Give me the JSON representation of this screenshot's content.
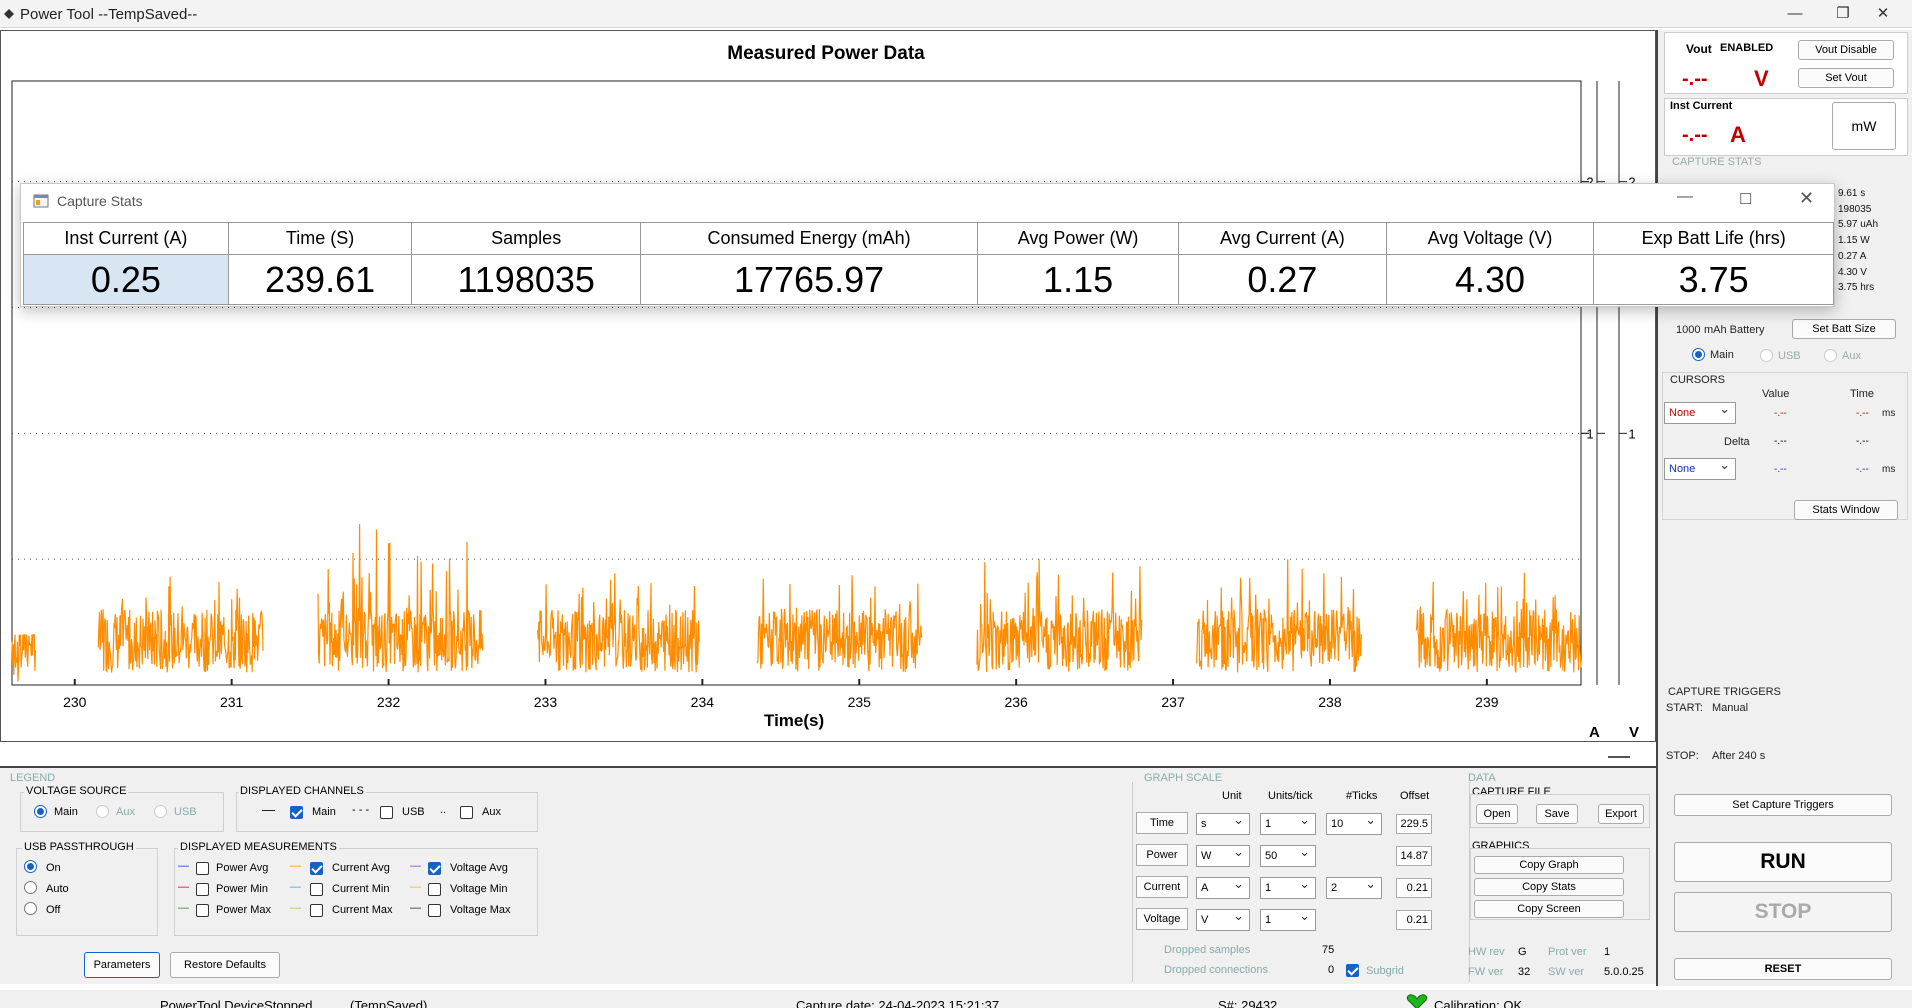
{
  "window": {
    "title": "Power Tool --TempSaved--",
    "controls": [
      "—",
      "❐",
      "✕"
    ]
  },
  "graph": {
    "title": "Measured Power Data",
    "xlabel": "Time(s)",
    "axis_units": [
      "A",
      "V"
    ]
  },
  "chart_data": {
    "type": "line",
    "title": "Measured Power Data",
    "xlabel": "Time(s)",
    "ylabel": "",
    "x_ticks": [
      230,
      231,
      232,
      233,
      234,
      235,
      236,
      237,
      238,
      239
    ],
    "y_right_ticks": [
      {
        "axis": "A",
        "values": [
          1,
          2
        ]
      },
      {
        "axis": "V",
        "values": [
          1,
          2
        ]
      }
    ],
    "xlim": [
      229.6,
      239.6
    ],
    "ylim": [
      0,
      2.4
    ],
    "grid": "horizontal dotted",
    "series": [
      {
        "color": "#ff8c00",
        "bursts": [
          {
            "start": 229.6,
            "end": 229.75,
            "peak": 0.2
          },
          {
            "start": 230.15,
            "end": 231.2,
            "peak": 0.45
          },
          {
            "start": 231.55,
            "end": 232.6,
            "peak": 0.65
          },
          {
            "start": 232.95,
            "end": 233.98,
            "peak": 0.45
          },
          {
            "start": 234.35,
            "end": 235.4,
            "peak": 0.45
          },
          {
            "start": 235.75,
            "end": 236.8,
            "peak": 0.5
          },
          {
            "start": 237.15,
            "end": 238.2,
            "peak": 0.5
          },
          {
            "start": 238.55,
            "end": 239.6,
            "peak": 0.45
          }
        ]
      }
    ]
  },
  "stats_window": {
    "title": "Capture Stats",
    "headers": [
      "Inst Current (A)",
      "Time (S)",
      "Samples",
      "Consumed Energy (mAh)",
      "Avg Power (W)",
      "Avg Current (A)",
      "Avg Voltage (V)",
      "Exp Batt Life (hrs)"
    ],
    "values": [
      "0.25",
      "239.61",
      "1198035",
      "17765.97",
      "1.15",
      "0.27",
      "4.30",
      "3.75"
    ]
  },
  "right": {
    "vout_label": "Vout",
    "vout_state": "ENABLED",
    "vout_disable": "Vout Disable",
    "vout_value": "-.--",
    "vout_unit": "V",
    "set_vout": "Set Vout",
    "inst_current_label": "Inst Current",
    "inst_current_value": "-.--",
    "inst_current_unit": "A",
    "mw_button": "mW",
    "capture_stats_label": "CAPTURE STATS",
    "stats_partial": [
      "9.61  s",
      "198035",
      "5.97  uAh",
      "1.15  W",
      "0.27  A",
      "4.30  V",
      "3.75  hrs"
    ],
    "battery_size": "1000",
    "battery_unit": "mAh Battery",
    "set_batt_size": "Set Batt Size",
    "radio_main": "Main",
    "radio_usb": "USB",
    "radio_aux": "Aux",
    "cursors_label": "CURSORS",
    "value_label": "Value",
    "time_label": "Time",
    "delta_label": "Delta",
    "cursor1_select": "None",
    "cursor2_select": "None",
    "dash": "-.--",
    "ms": "ms",
    "stats_window_btn": "Stats Window",
    "capture_triggers_label": "CAPTURE TRIGGERS",
    "start_label": "START:",
    "start_value": "Manual",
    "stop_label": "STOP:",
    "stop_value": "After 240 s",
    "set_capture_triggers": "Set Capture Triggers",
    "run": "RUN",
    "stop": "STOP",
    "reset": "RESET"
  },
  "bottom": {
    "legend_label": "LEGEND",
    "voltage_source": "VOLTAGE SOURCE",
    "vs_main": "Main",
    "vs_aux": "Aux",
    "vs_usb": "USB",
    "displayed_channels": "DISPLAYED CHANNELS",
    "ch_main": "Main",
    "ch_usb": "USB",
    "ch_aux": "Aux",
    "usb_passthrough": "USB PASSTHROUGH",
    "pt_on": "On",
    "pt_auto": "Auto",
    "pt_off": "Off",
    "displayed_measurements": "DISPLAYED MEASUREMENTS",
    "m_power_avg": "Power Avg",
    "m_power_min": "Power Min",
    "m_power_max": "Power Max",
    "m_current_avg": "Current Avg",
    "m_current_min": "Current Min",
    "m_current_max": "Current Max",
    "m_voltage_avg": "Voltage Avg",
    "m_voltage_min": "Voltage Min",
    "m_voltage_max": "Voltage Max",
    "parameters": "Parameters",
    "restore_defaults": "Restore Defaults",
    "graph_scale": "GRAPH SCALE",
    "col_unit": "Unit",
    "col_units_tick": "Units/tick",
    "col_ticks": "#Ticks",
    "col_offset": "Offset",
    "rows": [
      {
        "name": "Time",
        "unit": "s",
        "units_tick": "1",
        "ticks": "10",
        "offset": "229.5"
      },
      {
        "name": "Power",
        "unit": "W",
        "units_tick": "50",
        "ticks": "",
        "offset": "14.87"
      },
      {
        "name": "Current",
        "unit": "A",
        "units_tick": "1",
        "ticks": "2",
        "offset": "0.21"
      },
      {
        "name": "Voltage",
        "unit": "V",
        "units_tick": "1",
        "ticks": "",
        "offset": "0.21"
      }
    ],
    "dropped_samples_label": "Dropped samples",
    "dropped_samples": "75",
    "dropped_connections_label": "Dropped connections",
    "dropped_connections": "0",
    "subgrid": "Subgrid",
    "data_label": "DATA",
    "capture_file": "CAPTURE FILE",
    "open": "Open",
    "save": "Save",
    "export": "Export",
    "graphics": "GRAPHICS",
    "copy_graph": "Copy Graph",
    "copy_stats": "Copy Stats",
    "copy_screen": "Copy Screen",
    "hw_rev_label": "HW rev",
    "hw_rev": "G",
    "prot_ver_label": "Prot ver",
    "prot_ver": "1",
    "fw_ver_label": "FW ver",
    "fw_ver": "32",
    "sw_ver_label": "SW ver",
    "sw_ver": "5.0.0.25"
  },
  "status": {
    "device": "PowerTool DeviceStopped",
    "saved": "(TempSaved)",
    "capture_date": "Capture date: 24-04-2023 15:21:37",
    "serial": "S#: 29432",
    "calibration": "Calibration: OK"
  },
  "colors": {
    "trace": "#ff8c00",
    "accent": "#1662c4",
    "red_value": "#c00000"
  }
}
